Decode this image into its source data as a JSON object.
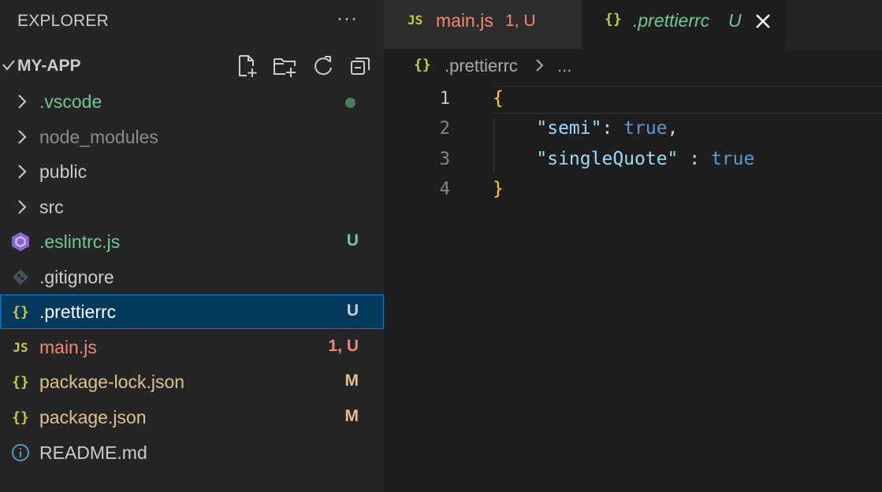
{
  "sidebar": {
    "title": "EXPLORER",
    "more_label": "···",
    "folder": {
      "name": "MY-APP",
      "actions": [
        "new-file-icon",
        "new-folder-icon",
        "refresh-icon",
        "collapse-all-icon"
      ]
    },
    "items": [
      {
        "label": ".vscode",
        "kind": "folder",
        "color": "#73c991",
        "badge": "",
        "status_dot": "#4c7d5b"
      },
      {
        "label": "node_modules",
        "kind": "folder",
        "color": "#8c8c8c",
        "badge": ""
      },
      {
        "label": "public",
        "kind": "folder",
        "color": "#cccccc",
        "badge": ""
      },
      {
        "label": "src",
        "kind": "folder",
        "color": "#cccccc",
        "badge": ""
      },
      {
        "label": ".eslintrc.js",
        "kind": "file",
        "icon": "eslint-icon",
        "color": "#73c991",
        "badge": "U",
        "badge_color": "#73c991"
      },
      {
        "label": ".gitignore",
        "kind": "file",
        "icon": "git-icon",
        "color": "#cccccc",
        "badge": ""
      },
      {
        "label": ".prettierrc",
        "kind": "file",
        "icon": "json-braces-icon",
        "icon_text": "{}",
        "color": "#ffffff",
        "badge": "U",
        "badge_color": "#cccccc",
        "selected": true
      },
      {
        "label": "main.js",
        "kind": "file",
        "icon": "javascript-icon",
        "icon_text": "JS",
        "color": "#f48771",
        "badge": "1, U",
        "badge_color": "#f48771"
      },
      {
        "label": "package-lock.json",
        "kind": "file",
        "icon": "json-braces-icon",
        "icon_text": "{}",
        "color": "#e2c08d",
        "badge": "M",
        "badge_color": "#e2c08d"
      },
      {
        "label": "package.json",
        "kind": "file",
        "icon": "json-braces-icon",
        "icon_text": "{}",
        "color": "#e2c08d",
        "badge": "M",
        "badge_color": "#e2c08d"
      },
      {
        "label": "README.md",
        "kind": "file",
        "icon": "info-icon",
        "color": "#cccccc",
        "badge": ""
      }
    ]
  },
  "tabs": [
    {
      "icon_text": "JS",
      "icon": "javascript-icon",
      "label": "main.js",
      "badge": "1, U",
      "active": false,
      "color": "#f48771"
    },
    {
      "icon_text": "{}",
      "icon": "json-braces-icon",
      "label": ".prettierrc",
      "badge": "U",
      "active": true,
      "color": "#73c991"
    }
  ],
  "breadcrumb": {
    "icon_text": "{}",
    "file": ".prettierrc",
    "more": "..."
  },
  "editor": {
    "line_numbers": [
      "1",
      "2",
      "3",
      "4"
    ],
    "lines": [
      [
        {
          "t": "{",
          "c": "brace"
        }
      ],
      [
        {
          "t": "    ",
          "c": "punct"
        },
        {
          "t": "\"semi\"",
          "c": "key"
        },
        {
          "t": ": ",
          "c": "punct"
        },
        {
          "t": "true",
          "c": "bool"
        },
        {
          "t": ",",
          "c": "punct"
        }
      ],
      [
        {
          "t": "    ",
          "c": "punct"
        },
        {
          "t": "\"singleQuote\"",
          "c": "key"
        },
        {
          "t": " : ",
          "c": "punct"
        },
        {
          "t": "true",
          "c": "bool"
        }
      ],
      [
        {
          "t": "}",
          "c": "brace"
        }
      ]
    ]
  },
  "colors": {
    "sidebar_bg": "#252526",
    "editor_bg": "#1e1e1e",
    "selection_bg": "#04395e",
    "selection_border": "#007fd4",
    "untracked": "#73c991",
    "modified": "#e2c08d",
    "error": "#f48771"
  }
}
